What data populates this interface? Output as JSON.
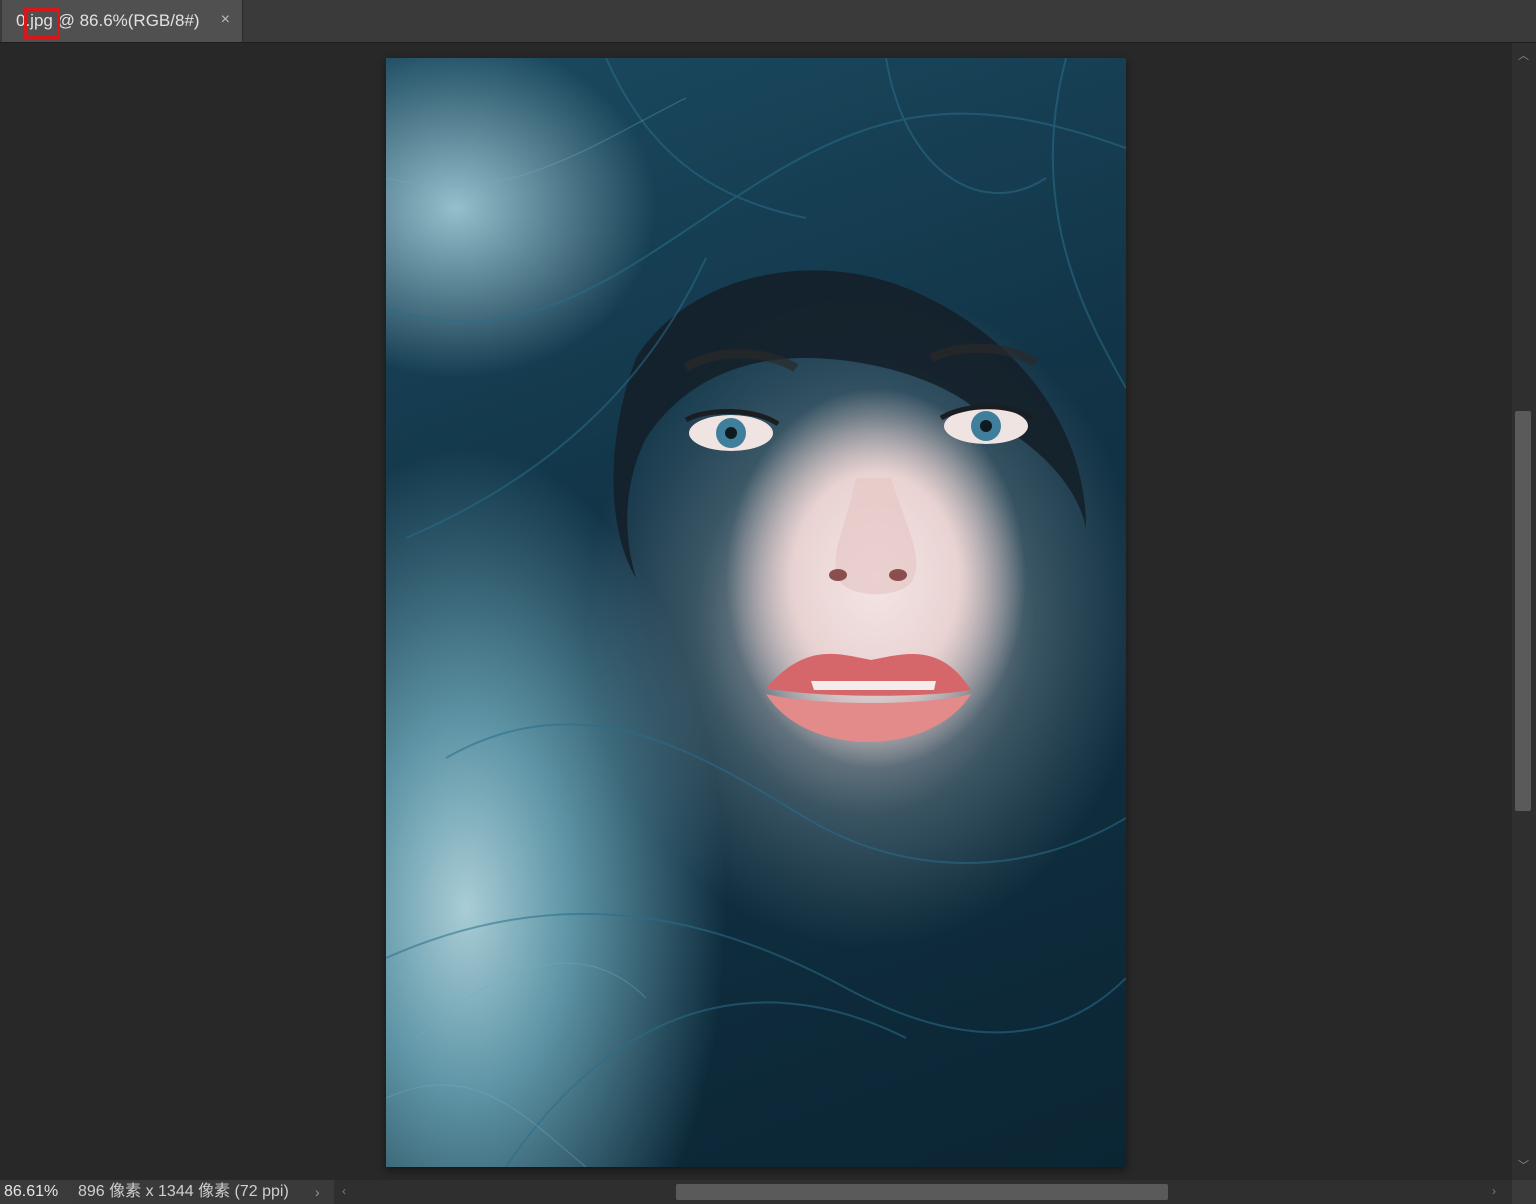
{
  "tab": {
    "title": "0.jpg @ 86.6%(RGB/8#)",
    "close_label": "×"
  },
  "status": {
    "zoom": "86.61%",
    "doc_info": "896 像素 x 1344 像素 (72 ppi)",
    "more_arrow": "›"
  },
  "scroll": {
    "up_arrow": "︿",
    "down_arrow": "﹀",
    "left_arrow": "‹",
    "right_arrow": "›"
  },
  "canvas": {
    "image_description": "portrait photo",
    "background_color": "#282828"
  },
  "colors": {
    "highlight_box": "#d9161b",
    "tab_active": "#505050",
    "tabbar": "#3a3a3a",
    "scroll_thumb": "#5a5a5a"
  }
}
